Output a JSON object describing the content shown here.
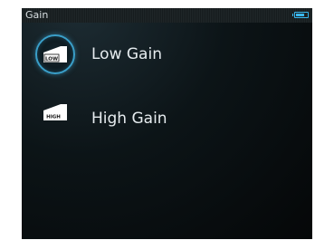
{
  "window": {
    "title": "Gain"
  },
  "status": {
    "battery_icon": "battery-icon",
    "accent_color": "#39b8ef"
  },
  "menu": {
    "items": [
      {
        "label": "Low Gain",
        "icon_text": "LOW",
        "icon": "low-gain-icon",
        "selected": true
      },
      {
        "label": "High Gain",
        "icon_text": "HIGH",
        "icon": "high-gain-icon",
        "selected": false
      }
    ]
  }
}
